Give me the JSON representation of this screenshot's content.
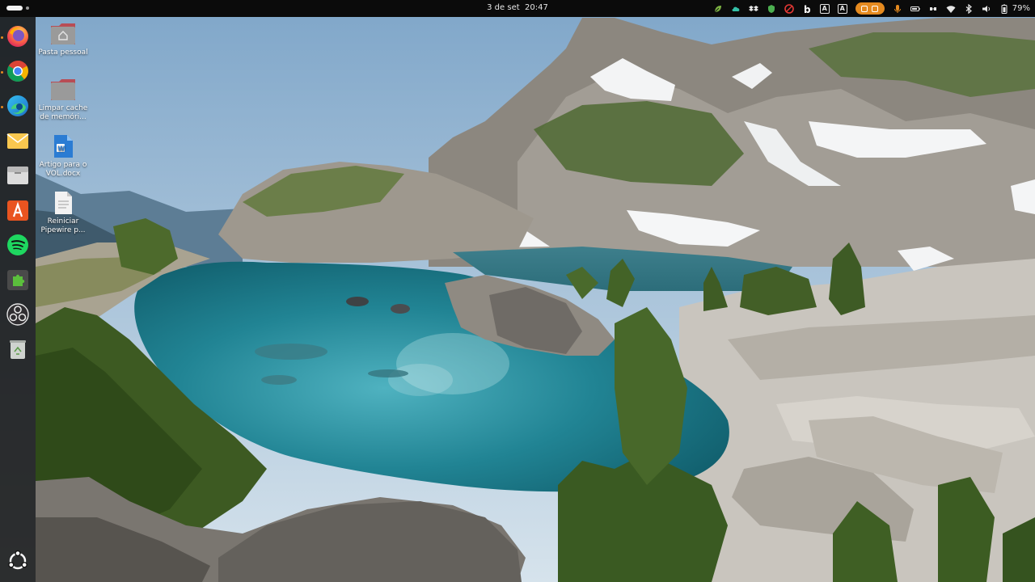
{
  "topbar": {
    "activities_icon": "activities-indicator",
    "date": "3 de set",
    "time": "20:47",
    "tray_icons": [
      "leaf-icon",
      "cloud-icon",
      "dropbox-icon",
      "shield-icon",
      "opera-icon",
      "bold-b-icon",
      "keyboard-a-icon",
      "keyboard-a-icon",
      "screen-record-icon",
      "microphone-icon",
      "battery-indicator-icon",
      "network-icon",
      "wifi-icon",
      "bluetooth-icon",
      "volume-icon",
      "battery-icon"
    ],
    "tray_letters": {
      "first": "A",
      "second": "A"
    },
    "battery_percent": "79%",
    "accent": "#e58a1f"
  },
  "dock": {
    "items": [
      {
        "name": "firefox",
        "icon": "firefox-icon"
      },
      {
        "name": "chrome",
        "icon": "chrome-icon"
      },
      {
        "name": "edge",
        "icon": "edge-icon"
      },
      {
        "name": "mail",
        "icon": "mail-icon"
      },
      {
        "name": "files",
        "icon": "files-icon"
      },
      {
        "name": "app-center",
        "icon": "app-center-icon"
      },
      {
        "name": "spotify",
        "icon": "spotify-icon"
      },
      {
        "name": "extensions",
        "icon": "puzzle-icon"
      },
      {
        "name": "obs",
        "icon": "obs-icon"
      },
      {
        "name": "trash",
        "icon": "trash-icon"
      }
    ],
    "show_apps_icon": "ubuntu-logo-icon"
  },
  "desktop": {
    "icons": [
      {
        "label": "Pasta pessoal",
        "icon": "home-folder-icon"
      },
      {
        "label": "Limpar cache de memóri...",
        "icon": "folder-icon"
      },
      {
        "label": "Artigo para o VOL.docx",
        "icon": "word-document-icon"
      },
      {
        "label": "Reiniciar Pipewire p...",
        "icon": "text-file-icon"
      }
    ]
  },
  "wallpaper": {
    "subject": "alpine-lake-landscape",
    "colors": {
      "sky": "#a9c6dd",
      "lake": "#2a8fa3",
      "rock": "#bdb9b2",
      "forest": "#4f6b2e"
    }
  }
}
